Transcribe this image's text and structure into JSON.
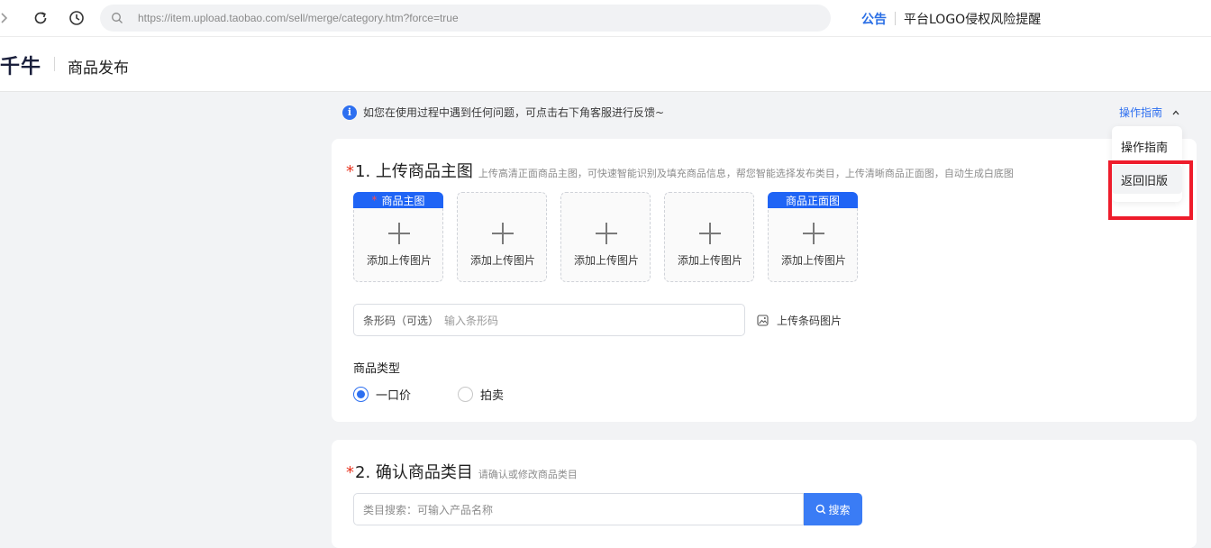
{
  "browser": {
    "url": "https://item.upload.taobao.com/sell/merge/category.htm?force=true",
    "announce_label": "公告",
    "announce_text": "平台LOGO侵权风险提醒"
  },
  "header": {
    "logo": "千牛",
    "page_title": "商品发布"
  },
  "notice": {
    "text": "如您在使用过程中遇到任何问题，可点击右下角客服进行反馈~",
    "guide_label": "操作指南"
  },
  "dropdown": {
    "items": [
      "操作指南",
      "返回旧版"
    ]
  },
  "section1": {
    "required_mark": "*",
    "title": "1. 上传商品主图",
    "hint": "上传高清正面商品主图，可快速智能识别及填充商品信息，帮您智能选择发布类目，上传清晰商品正面图，自动生成白底图",
    "uploads": [
      {
        "tag_star": "*",
        "tag": "商品主图",
        "label": "添加上传图片"
      },
      {
        "tag": "",
        "label": "添加上传图片"
      },
      {
        "tag": "",
        "label": "添加上传图片"
      },
      {
        "tag": "",
        "label": "添加上传图片"
      },
      {
        "tag": "商品正面图",
        "label": "添加上传图片"
      }
    ],
    "barcode_label": "条形码（可选）",
    "barcode_placeholder": "输入条形码",
    "barcode_upload": "上传条码图片",
    "type_label": "商品类型",
    "types": [
      {
        "label": "一口价",
        "selected": true
      },
      {
        "label": "拍卖",
        "selected": false
      }
    ]
  },
  "section2": {
    "required_mark": "*",
    "title": "2. 确认商品类目",
    "hint": "请确认或修改商品类目",
    "search_placeholder": "类目搜索：可输入产品名称",
    "search_button": "搜索"
  },
  "colors": {
    "accent": "#2d6ff0",
    "tag_blue": "#1f64f5",
    "highlight_red": "#ee1c2b",
    "required_red": "#e8341f"
  }
}
